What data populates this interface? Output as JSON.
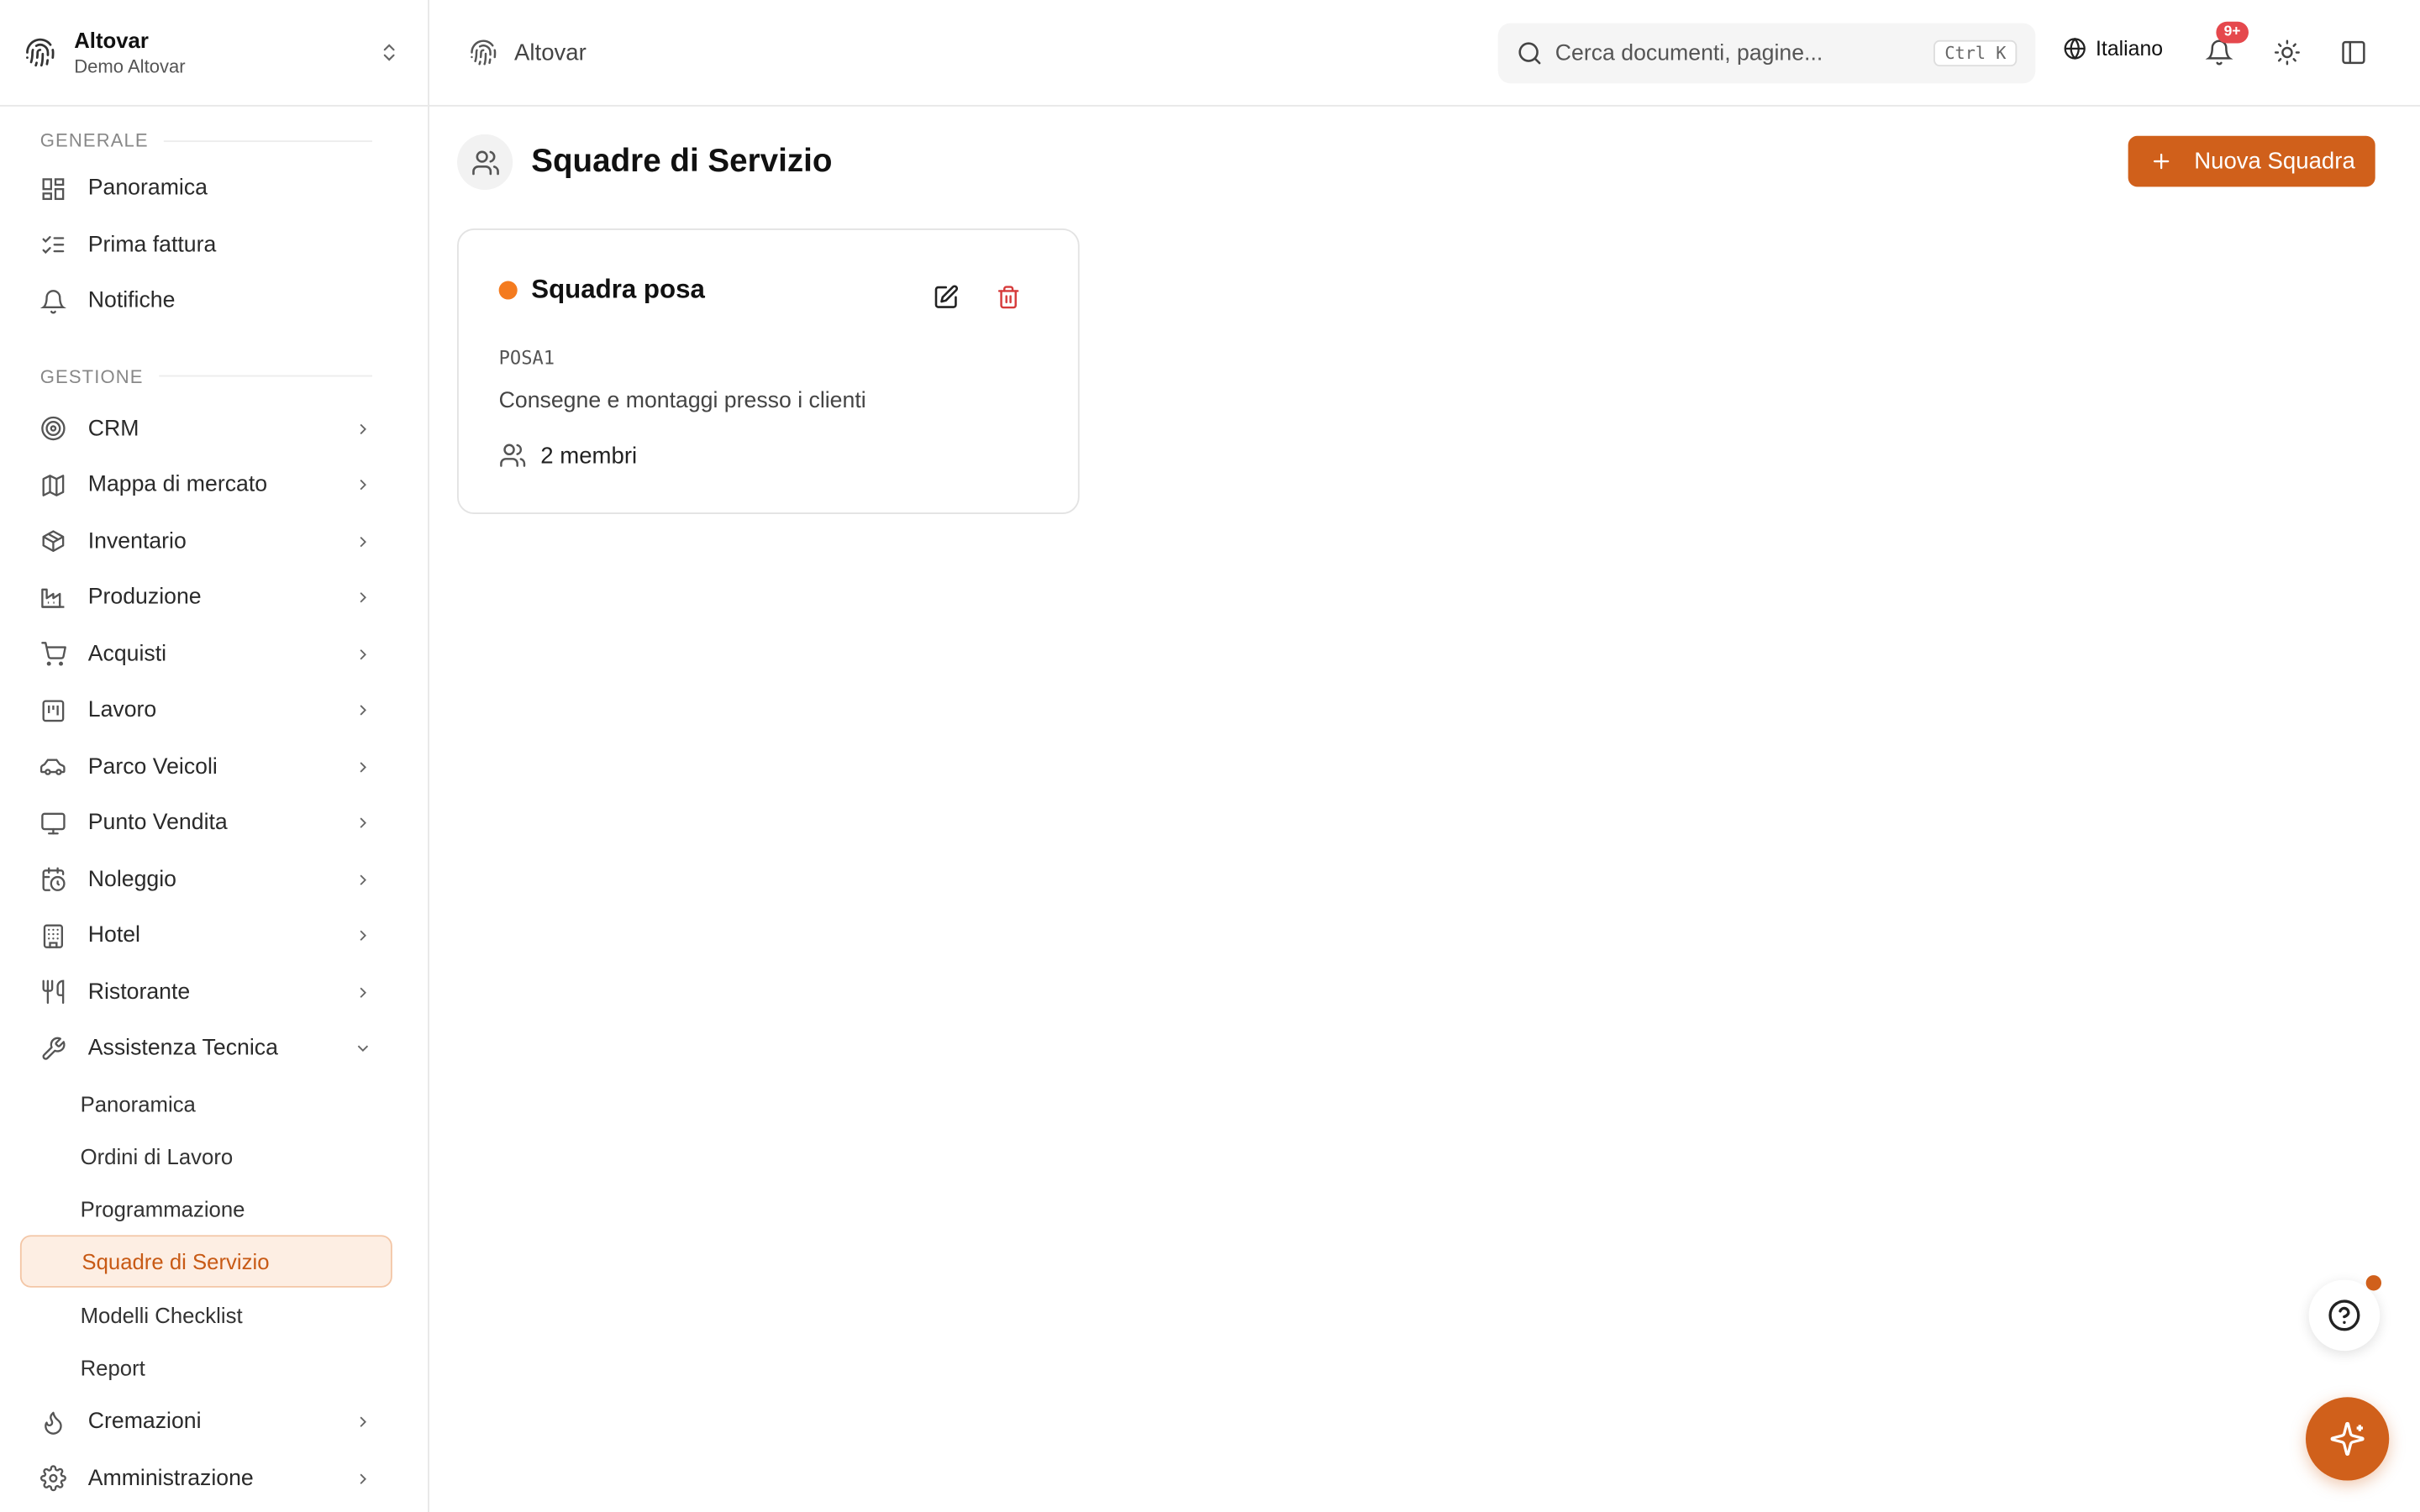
{
  "brand": {
    "name": "Altovar",
    "subtitle": "Demo Altovar"
  },
  "topbar": {
    "breadcrumb": "Altovar",
    "search_placeholder": "Cerca documenti, pagine...",
    "search_shortcut": "Ctrl K",
    "language": "Italiano",
    "notifications_badge": "9+"
  },
  "sidebar": {
    "sections": [
      {
        "label": "GENERALE",
        "items": [
          {
            "label": "Panoramica",
            "icon": "dashboard-icon"
          },
          {
            "label": "Prima fattura",
            "icon": "checklist-icon"
          },
          {
            "label": "Notifiche",
            "icon": "bell-icon"
          }
        ]
      },
      {
        "label": "GESTIONE",
        "items": [
          {
            "label": "CRM",
            "icon": "target-icon"
          },
          {
            "label": "Mappa di mercato",
            "icon": "map-icon"
          },
          {
            "label": "Inventario",
            "icon": "package-icon"
          },
          {
            "label": "Produzione",
            "icon": "factory-icon"
          },
          {
            "label": "Acquisti",
            "icon": "cart-icon"
          },
          {
            "label": "Lavoro",
            "icon": "kanban-icon"
          },
          {
            "label": "Parco Veicoli",
            "icon": "car-icon"
          },
          {
            "label": "Punto Vendita",
            "icon": "monitor-icon"
          },
          {
            "label": "Noleggio",
            "icon": "calendar-clock-icon"
          },
          {
            "label": "Hotel",
            "icon": "building-icon"
          },
          {
            "label": "Ristorante",
            "icon": "utensils-icon"
          },
          {
            "label": "Assistenza Tecnica",
            "icon": "wrench-icon"
          }
        ]
      }
    ],
    "assistenza_sub": [
      "Panoramica",
      "Ordini di Lavoro",
      "Programmazione",
      "Squadre di Servizio",
      "Modelli Checklist",
      "Report"
    ],
    "after_items": [
      {
        "label": "Cremazioni",
        "icon": "flame-icon"
      },
      {
        "label": "Amministrazione",
        "icon": "gear-icon"
      }
    ]
  },
  "main": {
    "title": "Squadre di Servizio",
    "new_button": "Nuova Squadra",
    "team_card": {
      "name": "Squadra posa",
      "code": "POSA1",
      "description": "Consegne e montaggi presso i clienti",
      "members": "2 membri",
      "status_color": "#f47b1f"
    }
  },
  "colors": {
    "accent": "#d0601b",
    "active_bg": "#fdeee3",
    "danger": "#d63b3b"
  }
}
